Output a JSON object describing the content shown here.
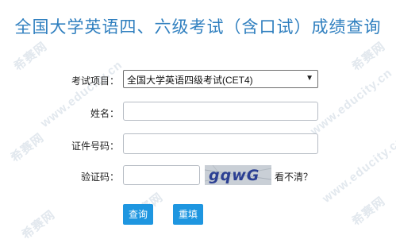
{
  "title": "全国大学英语四、六级考试（含口试）成绩查询",
  "form": {
    "exam_label": "考试项目：",
    "exam_selected": "全国大学英语四级考试(CET4)",
    "name_label": "姓名：",
    "id_label": "证件号码：",
    "captcha_label": "验证码：",
    "captcha_text": "gqwG",
    "refresh_text": "看不清？"
  },
  "buttons": {
    "query": "查询",
    "reset": "重填"
  },
  "watermarks": [
    "希赛网",
    "www.educity.cn"
  ],
  "colors": {
    "title": "#2f7fbf",
    "button": "#1e96e0"
  }
}
